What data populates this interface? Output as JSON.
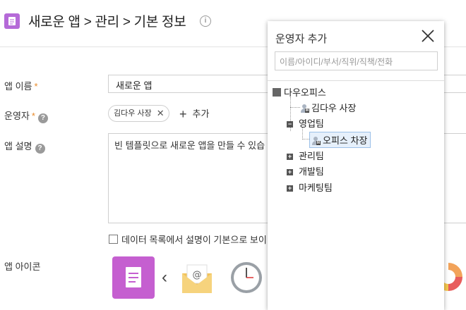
{
  "breadcrumb": {
    "app": "새로운 앱",
    "sep": ">",
    "section": "관리",
    "page": "기본 정보"
  },
  "form": {
    "name_label": "앱 이름",
    "name_value": "새로운 앱",
    "operator_label": "운영자",
    "operator_chip": "김다우 사장",
    "add_operator": "추가",
    "desc_label": "앱 설명",
    "desc_value": "빈 템플릿으로 새로운 앱을 만들 수 있습",
    "desc_checkbox": "데이터 목록에서 설명이 기본으로 보이",
    "icon_label": "앱 아이콘",
    "required_mark": "*"
  },
  "popup": {
    "title": "운영자 추가",
    "search_placeholder": "이름/아이디/부서/직위/직책/전화",
    "tree": {
      "root": "다우오피스",
      "root_user": "김다우 사장",
      "dept1": "영업팀",
      "dept1_user": "오피스 차장",
      "dept2": "관리팀",
      "dept3": "개발팀",
      "dept4": "마케팅팀"
    }
  },
  "colors": {
    "app_badge": "#b56ad8",
    "icon_tile": "#c55fd0",
    "required": "#e88a2a"
  }
}
